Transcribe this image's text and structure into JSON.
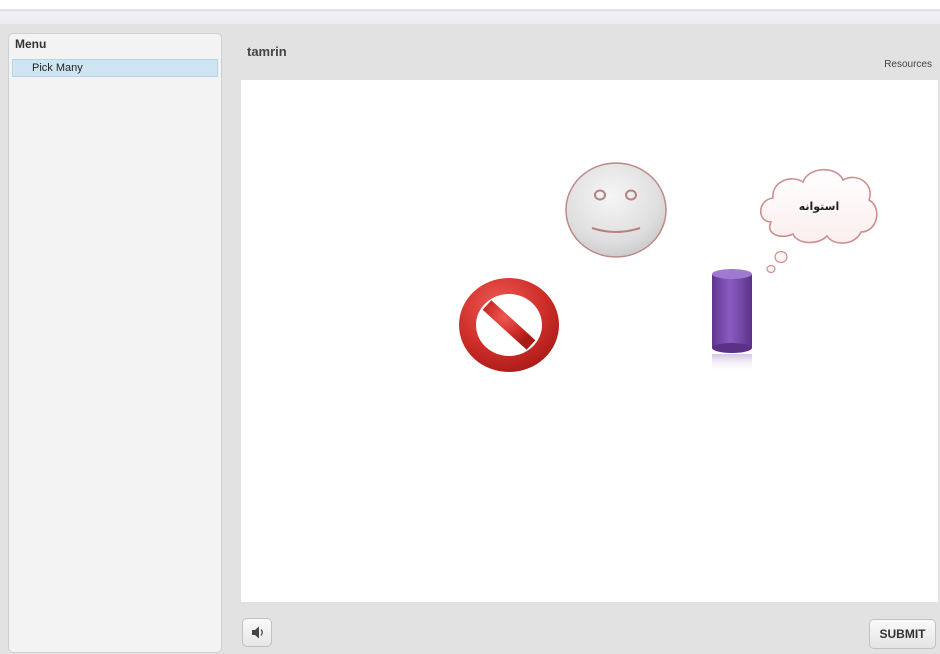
{
  "menu": {
    "tab_label": "Menu",
    "items": [
      {
        "label": "Pick Many",
        "selected": true
      }
    ]
  },
  "header": {
    "title": "tamrin",
    "resources_label": "Resources"
  },
  "stage": {
    "cloud_text": "استوانه",
    "objects": [
      "no-entry-sign",
      "smiley-face",
      "thought-cloud",
      "purple-cylinder"
    ]
  },
  "footer": {
    "sound_icon": "speaker-icon",
    "submit_label": "SUBMIT"
  },
  "colors": {
    "selected_item": "#cfe5f3",
    "no_sign_red": "#d0312d",
    "cylinder_purple": "#7a4bab",
    "cloud_border": "#c98a8a"
  }
}
